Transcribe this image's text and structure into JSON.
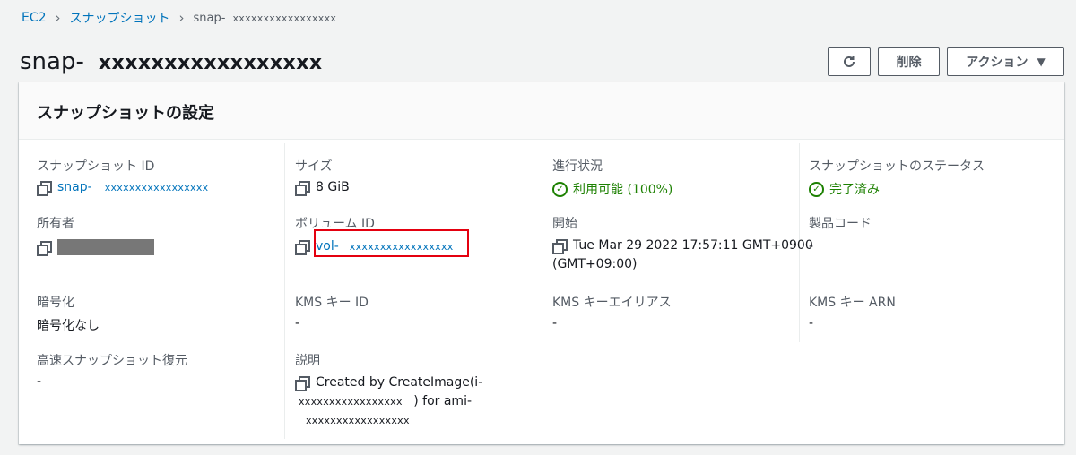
{
  "breadcrumb": {
    "ec2": "EC2",
    "snapshots": "スナップショット",
    "current_prefix": "snap-",
    "current_id": "xxxxxxxxxxxxxxxxx"
  },
  "page": {
    "title_prefix": "snap-",
    "title_id": "xxxxxxxxxxxxxxxxx"
  },
  "toolbar": {
    "refresh_icon": "refresh-icon",
    "delete_label": "削除",
    "actions_label": "アクション",
    "actions_caret": "▼"
  },
  "panel": {
    "title": "スナップショットの設定"
  },
  "fields": {
    "snapshot_id": {
      "label": "スナップショット ID",
      "prefix": "snap-",
      "id": "xxxxxxxxxxxxxxxxx"
    },
    "size": {
      "label": "サイズ",
      "value": "8 GiB"
    },
    "progress": {
      "label": "進行状況",
      "value": "利用可能 (100%)"
    },
    "status": {
      "label": "スナップショットのステータス",
      "value": "完了済み"
    },
    "owner": {
      "label": "所有者"
    },
    "volume_id": {
      "label": "ボリューム ID",
      "prefix": "vol-",
      "id": "xxxxxxxxxxxxxxxxx"
    },
    "started": {
      "label": "開始",
      "line1": "Tue Mar 29 2022 17:57:11 GMT+0900",
      "line2": "(GMT+09:00)"
    },
    "product_code": {
      "label": "製品コード",
      "value": "-"
    },
    "encryption": {
      "label": "暗号化",
      "value": "暗号化なし"
    },
    "kms_key_id": {
      "label": "KMS キー ID",
      "value": "-"
    },
    "kms_key_alias": {
      "label": "KMS キーエイリアス",
      "value": "-"
    },
    "kms_key_arn": {
      "label": "KMS キー ARN",
      "value": "-"
    },
    "fast_restore": {
      "label": "高速スナップショット復元",
      "value": "-"
    },
    "description": {
      "label": "説明",
      "line1": "Created by CreateImage(i-",
      "line2_id": "xxxxxxxxxxxxxxxxx",
      "line2_rest": ") for ami-",
      "line3_id": "xxxxxxxxxxxxxxxxx"
    }
  },
  "colors": {
    "link": "#0073bb",
    "success": "#1d8102",
    "highlight": "#e4000f"
  }
}
